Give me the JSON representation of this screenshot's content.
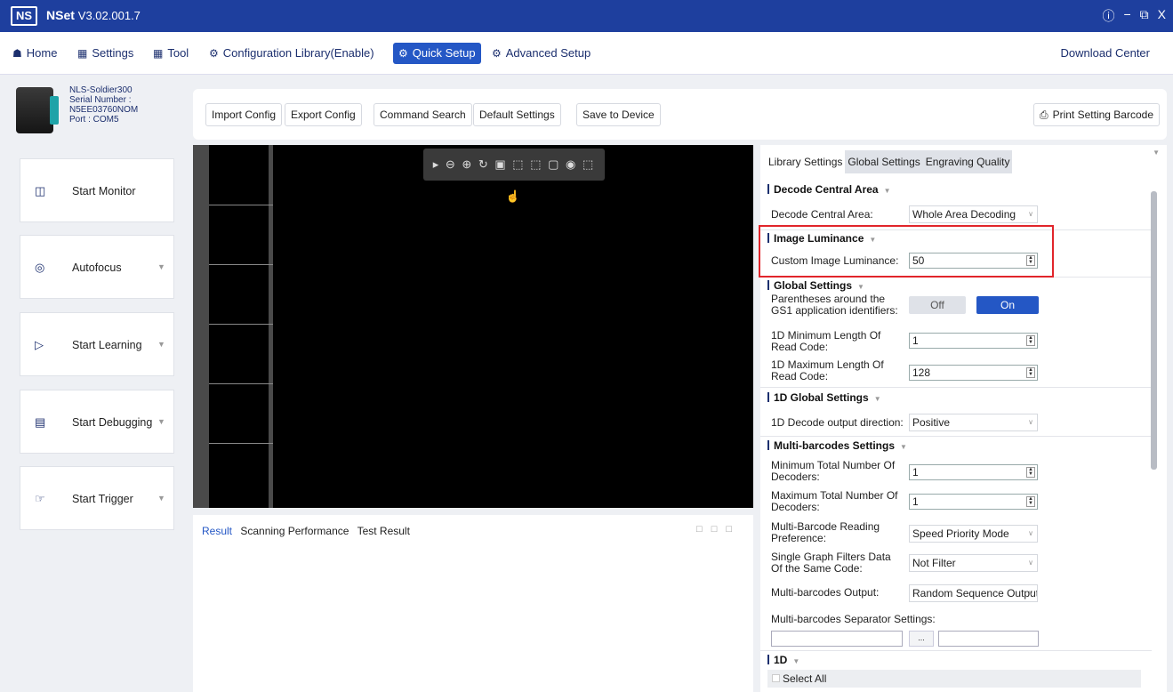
{
  "window": {
    "logo": "NS",
    "name": "NSet",
    "version": "V3.02.001.7",
    "controls": [
      "ⓘ",
      "−",
      "⧉",
      "X"
    ]
  },
  "menu": {
    "home": "Home",
    "settings": "Settings",
    "tool": "Tool",
    "config_lib": "Configuration Library(Enable)",
    "quick": "Quick Setup",
    "advanced": "Advanced Setup",
    "download": "Download Center"
  },
  "device": {
    "model": "NLS-Soldier300",
    "serial_label": "Serial Number :",
    "serial": "N5EE03760NOM",
    "port": "Port : COM5"
  },
  "toolbar": {
    "import": "Import Config",
    "export": "Export Config",
    "command": "Command Search",
    "default": "Default Settings",
    "save": "Save to Device",
    "print": "Print Setting Barcode"
  },
  "sidebar": [
    {
      "label": "Start Monitor",
      "icon": "monitor-icon"
    },
    {
      "label": "Autofocus",
      "icon": "focus-icon"
    },
    {
      "label": "Start Learning",
      "icon": "play-icon"
    },
    {
      "label": "Start Debugging",
      "icon": "debug-icon"
    },
    {
      "label": "Start Trigger",
      "icon": "trigger-icon"
    }
  ],
  "video_tools": "▸ ⊖ ⊕ ↻ ▣ ⬚ ⬚ ▢ ◉ ⬚ ☝",
  "result": {
    "tabs": [
      "Result",
      "Scanning Performance",
      "Test Result"
    ],
    "active": "Result"
  },
  "panel": {
    "tabs": [
      "Library Settings",
      "Global Settings",
      "Engraving Quality"
    ],
    "selected_tab": "Global Settings",
    "decode_central": {
      "title": "Decode Central Area",
      "label": "Decode Central Area:",
      "value": "Whole Area Decoding"
    },
    "luminance": {
      "title": "Image Luminance",
      "label": "Custom Image Luminance:",
      "value": "50"
    },
    "global": {
      "title": "Global Settings",
      "gs1_label": "Parentheses around the GS1 application identifiers:",
      "off": "Off",
      "on": "On",
      "state": "On",
      "min_label": "1D Minimum Length Of Read Code:",
      "min_value": "1",
      "max_label": "1D Maximum Length Of Read Code:",
      "max_value": "128"
    },
    "oned_global": {
      "title": "1D Global Settings",
      "dir_label": "1D Decode output direction:",
      "dir_value": "Positive"
    },
    "multi": {
      "title": "Multi-barcodes Settings",
      "min_label": "Minimum Total Number Of Decoders:",
      "min_value": "1",
      "max_label": "Maximum Total Number Of Decoders:",
      "max_value": "1",
      "pref_label": "Multi-Barcode Reading Preference:",
      "pref_value": "Speed Priority Mode",
      "filter_label": "Single Graph Filters Data Of the Same Code:",
      "filter_value": "Not Filter",
      "output_label": "Multi-barcodes Output:",
      "output_value": "Random Sequence Output",
      "sep_label": "Multi-barcodes Separator Settings:",
      "sep_btn": "..."
    },
    "oned": {
      "title": "1D",
      "select_all": "Select All"
    }
  },
  "colors": {
    "titlebar": "#1e3f9e",
    "accent": "#2457c5",
    "highlight": "#e1252b"
  }
}
